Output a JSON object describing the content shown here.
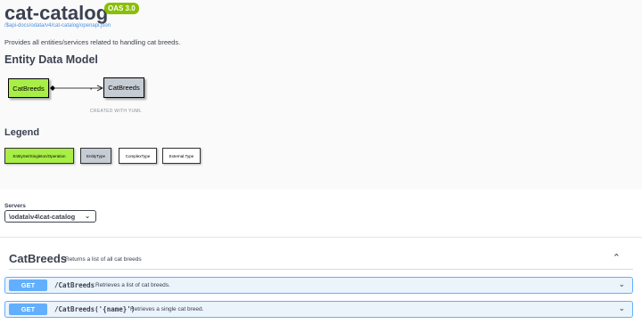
{
  "info": {
    "title": "cat-catalog",
    "version_badge": "OAS 3.0",
    "spec_link": "/$api-docs/odata/v4/cat-catalog/openapi.json",
    "description": "Provides all entities/services related to handling cat breeds."
  },
  "edm": {
    "heading": "Entity Data Model",
    "source_entity": "CatBreeds",
    "target_entity": "CatBreeds",
    "multiplicity": "*",
    "credit": "CREATED WITH YUML"
  },
  "legend": {
    "heading": "Legend",
    "items": [
      "EntitySet/Singleton/Operation",
      "EntityType",
      "ComplexType",
      "External.Type"
    ]
  },
  "servers": {
    "label": "Servers",
    "selected": "\\odata\\v4\\cat-catalog"
  },
  "tag": {
    "name": "CatBreeds",
    "description": "Returns a list of all cat breeds"
  },
  "operations": [
    {
      "method": "GET",
      "path": "/CatBreeds",
      "summary": "Retrieves a list of cat breeds."
    },
    {
      "method": "GET",
      "path": "/CatBreeds('{name}')",
      "summary": "Retrieves a single cat breed."
    }
  ],
  "colors": {
    "get_method": "#61affe",
    "entity_set": "#a8ee46",
    "entity_type": "#c6ccd3",
    "badge": "#89bf04"
  },
  "icons": {
    "collapse": "chevron-up-icon",
    "expand": "chevron-down-icon"
  }
}
